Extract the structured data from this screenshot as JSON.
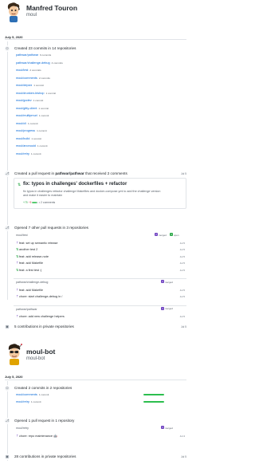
{
  "profiles": [
    {
      "name": "Manfred Touron",
      "login": "moul"
    },
    {
      "name": "moul-bot",
      "login": "moul-bot"
    }
  ],
  "manfred": {
    "date": "July 5, 2020",
    "commits_event": {
      "title": "Created 23 commits in 14 repositories",
      "repos": [
        {
          "name": "pathwar/pathwar",
          "count": "6 commits"
        },
        {
          "name": "pathwar/challenge-debug",
          "count": "4 commits"
        },
        {
          "name": "moul/test",
          "count": "2 commits"
        },
        {
          "name": "moul/comments",
          "count": "2 commits"
        },
        {
          "name": "moul/depviz",
          "count": "1 commit"
        },
        {
          "name": "moul/drunken-bishop",
          "count": "1 commit"
        },
        {
          "name": "moul/godev",
          "count": "1 commit"
        },
        {
          "name": "moul/gitty-client",
          "count": "1 commit"
        },
        {
          "name": "moul/multipmuri",
          "count": "1 commit"
        },
        {
          "name": "moul/cli",
          "count": "1 commit"
        },
        {
          "name": "moul/progress",
          "count": "1 commit"
        },
        {
          "name": "moul/build",
          "count": "1 commit"
        },
        {
          "name": "moul/anonuuid",
          "count": "1 commit"
        },
        {
          "name": "moul/retry",
          "count": "1 commit"
        }
      ]
    },
    "pr_event": {
      "title_prefix": "Created a pull request in",
      "repo": "pathwar/pathwar",
      "title_suffix": "that received 2 comments",
      "time": "Jul 5",
      "pr_title": "fix: typos in challenges' dockerfiles + refactor",
      "pr_body": "fix typos in challenges refactor challenge Makefiles and docker-compose.yml to add the challenge version and make it easier to maintain",
      "additions": "+75",
      "deletions": "−9",
      "comments": "2 comments"
    },
    "opened_event": {
      "title": "Opened 7 other pull requests in 3 repositories",
      "groups": [
        {
          "repo": "moul/test",
          "merged_count": "2",
          "merged_label": "merged",
          "open_count": "3",
          "open_label": "open",
          "items": [
            {
              "title": "feat: set up semantic release",
              "time": "Jul 5",
              "state": "merged"
            },
            {
              "title": "another test 2",
              "time": "Jul 5",
              "state": "open"
            },
            {
              "title": "feat: add release-note",
              "time": "Jul 5",
              "state": "open"
            },
            {
              "title": "feat: add Makefile",
              "time": "Jul 5",
              "state": "merged"
            },
            {
              "title": "feat: a first test :)",
              "time": "Jul 5",
              "state": "open"
            }
          ]
        },
        {
          "repo": "pathwar/challenge-debug",
          "merged_count": "2",
          "merged_label": "merged",
          "items": [
            {
              "title": "feat: add Makefile",
              "time": "Jul 5",
              "state": "merged"
            },
            {
              "title": "chore: start challenge-debug in /",
              "time": "Jul 5",
              "state": "merged"
            }
          ]
        },
        {
          "repo": "pathwar/pathwar",
          "merged_count": "1",
          "merged_label": "merged",
          "items": [
            {
              "title": "chore: add new challenge helpers",
              "time": "Jul 5",
              "state": "merged"
            }
          ]
        }
      ]
    },
    "private_event": {
      "title": "5 contributions in private repositories",
      "time": "Jul 5"
    }
  },
  "bot": {
    "date": "July 5, 2020",
    "commits_event": {
      "title": "Created 2 commits in 2 repositories",
      "repos": [
        {
          "name": "moul/comments",
          "count": "1 commit"
        },
        {
          "name": "moul/retry",
          "count": "1 commit"
        }
      ]
    },
    "opened_event": {
      "title": "Opened 1 pull request in 1 repository",
      "repo": "moul/retry",
      "merged_count": "1",
      "merged_label": "merged",
      "item": {
        "title": "chore: repo maintenance 🤖",
        "time": "Jul 4"
      }
    },
    "private_event": {
      "title": "28 contributions in private repositories",
      "time": "Jul 5"
    }
  },
  "colors": {
    "link": "#0366d6",
    "merged": "#6f42c1",
    "open": "#28a745",
    "bar": "#2cbe4e"
  }
}
